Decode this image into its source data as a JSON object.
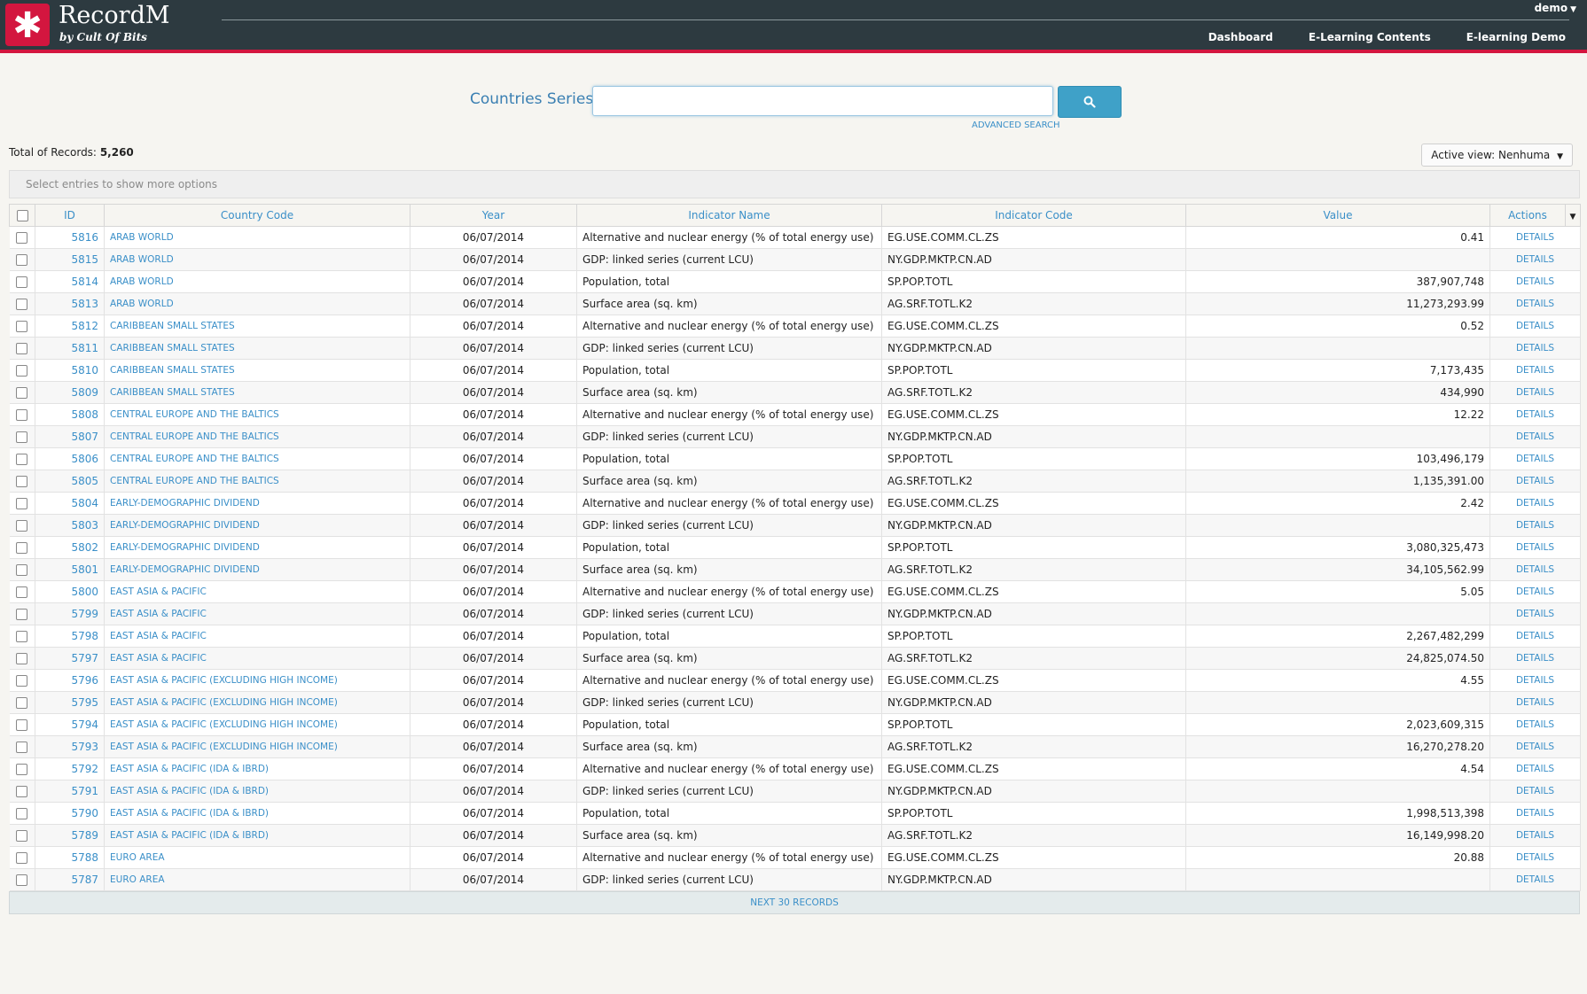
{
  "header": {
    "logo_glyph": "✱",
    "brand": "RecordM",
    "tagline": "by Cult Of Bits",
    "user": "demo",
    "nav": [
      "Dashboard",
      "E-Learning Contents",
      "E-learning Demo"
    ]
  },
  "search": {
    "label": "Countries Series",
    "value": "",
    "advanced_label": "ADVANCED SEARCH"
  },
  "records": {
    "total_label": "Total of Records:",
    "total_value": "5,260",
    "active_view_label": "Active view:",
    "active_view_value": "Nenhuma",
    "options_hint": "Select entries to show more options"
  },
  "table": {
    "columns": [
      "ID",
      "Country Code",
      "Year",
      "Indicator Name",
      "Indicator Code",
      "Value",
      "Actions"
    ],
    "action_label": "DETAILS",
    "rows": [
      {
        "id": "5816",
        "country": "ARAB WORLD",
        "year": "06/07/2014",
        "indicator_name": "Alternative and nuclear energy (% of total energy use)",
        "indicator_code": "EG.USE.COMM.CL.ZS",
        "value": "0.41"
      },
      {
        "id": "5815",
        "country": "ARAB WORLD",
        "year": "06/07/2014",
        "indicator_name": "GDP: linked series (current LCU)",
        "indicator_code": "NY.GDP.MKTP.CN.AD",
        "value": ""
      },
      {
        "id": "5814",
        "country": "ARAB WORLD",
        "year": "06/07/2014",
        "indicator_name": "Population, total",
        "indicator_code": "SP.POP.TOTL",
        "value": "387,907,748"
      },
      {
        "id": "5813",
        "country": "ARAB WORLD",
        "year": "06/07/2014",
        "indicator_name": "Surface area (sq. km)",
        "indicator_code": "AG.SRF.TOTL.K2",
        "value": "11,273,293.99"
      },
      {
        "id": "5812",
        "country": "CARIBBEAN SMALL STATES",
        "year": "06/07/2014",
        "indicator_name": "Alternative and nuclear energy (% of total energy use)",
        "indicator_code": "EG.USE.COMM.CL.ZS",
        "value": "0.52"
      },
      {
        "id": "5811",
        "country": "CARIBBEAN SMALL STATES",
        "year": "06/07/2014",
        "indicator_name": "GDP: linked series (current LCU)",
        "indicator_code": "NY.GDP.MKTP.CN.AD",
        "value": ""
      },
      {
        "id": "5810",
        "country": "CARIBBEAN SMALL STATES",
        "year": "06/07/2014",
        "indicator_name": "Population, total",
        "indicator_code": "SP.POP.TOTL",
        "value": "7,173,435"
      },
      {
        "id": "5809",
        "country": "CARIBBEAN SMALL STATES",
        "year": "06/07/2014",
        "indicator_name": "Surface area (sq. km)",
        "indicator_code": "AG.SRF.TOTL.K2",
        "value": "434,990"
      },
      {
        "id": "5808",
        "country": "CENTRAL EUROPE AND THE BALTICS",
        "year": "06/07/2014",
        "indicator_name": "Alternative and nuclear energy (% of total energy use)",
        "indicator_code": "EG.USE.COMM.CL.ZS",
        "value": "12.22"
      },
      {
        "id": "5807",
        "country": "CENTRAL EUROPE AND THE BALTICS",
        "year": "06/07/2014",
        "indicator_name": "GDP: linked series (current LCU)",
        "indicator_code": "NY.GDP.MKTP.CN.AD",
        "value": ""
      },
      {
        "id": "5806",
        "country": "CENTRAL EUROPE AND THE BALTICS",
        "year": "06/07/2014",
        "indicator_name": "Population, total",
        "indicator_code": "SP.POP.TOTL",
        "value": "103,496,179"
      },
      {
        "id": "5805",
        "country": "CENTRAL EUROPE AND THE BALTICS",
        "year": "06/07/2014",
        "indicator_name": "Surface area (sq. km)",
        "indicator_code": "AG.SRF.TOTL.K2",
        "value": "1,135,391.00"
      },
      {
        "id": "5804",
        "country": "EARLY-DEMOGRAPHIC DIVIDEND",
        "year": "06/07/2014",
        "indicator_name": "Alternative and nuclear energy (% of total energy use)",
        "indicator_code": "EG.USE.COMM.CL.ZS",
        "value": "2.42"
      },
      {
        "id": "5803",
        "country": "EARLY-DEMOGRAPHIC DIVIDEND",
        "year": "06/07/2014",
        "indicator_name": "GDP: linked series (current LCU)",
        "indicator_code": "NY.GDP.MKTP.CN.AD",
        "value": ""
      },
      {
        "id": "5802",
        "country": "EARLY-DEMOGRAPHIC DIVIDEND",
        "year": "06/07/2014",
        "indicator_name": "Population, total",
        "indicator_code": "SP.POP.TOTL",
        "value": "3,080,325,473"
      },
      {
        "id": "5801",
        "country": "EARLY-DEMOGRAPHIC DIVIDEND",
        "year": "06/07/2014",
        "indicator_name": "Surface area (sq. km)",
        "indicator_code": "AG.SRF.TOTL.K2",
        "value": "34,105,562.99"
      },
      {
        "id": "5800",
        "country": "EAST ASIA & PACIFIC",
        "year": "06/07/2014",
        "indicator_name": "Alternative and nuclear energy (% of total energy use)",
        "indicator_code": "EG.USE.COMM.CL.ZS",
        "value": "5.05"
      },
      {
        "id": "5799",
        "country": "EAST ASIA & PACIFIC",
        "year": "06/07/2014",
        "indicator_name": "GDP: linked series (current LCU)",
        "indicator_code": "NY.GDP.MKTP.CN.AD",
        "value": ""
      },
      {
        "id": "5798",
        "country": "EAST ASIA & PACIFIC",
        "year": "06/07/2014",
        "indicator_name": "Population, total",
        "indicator_code": "SP.POP.TOTL",
        "value": "2,267,482,299"
      },
      {
        "id": "5797",
        "country": "EAST ASIA & PACIFIC",
        "year": "06/07/2014",
        "indicator_name": "Surface area (sq. km)",
        "indicator_code": "AG.SRF.TOTL.K2",
        "value": "24,825,074.50"
      },
      {
        "id": "5796",
        "country": "EAST ASIA & PACIFIC (EXCLUDING HIGH INCOME)",
        "year": "06/07/2014",
        "indicator_name": "Alternative and nuclear energy (% of total energy use)",
        "indicator_code": "EG.USE.COMM.CL.ZS",
        "value": "4.55"
      },
      {
        "id": "5795",
        "country": "EAST ASIA & PACIFIC (EXCLUDING HIGH INCOME)",
        "year": "06/07/2014",
        "indicator_name": "GDP: linked series (current LCU)",
        "indicator_code": "NY.GDP.MKTP.CN.AD",
        "value": ""
      },
      {
        "id": "5794",
        "country": "EAST ASIA & PACIFIC (EXCLUDING HIGH INCOME)",
        "year": "06/07/2014",
        "indicator_name": "Population, total",
        "indicator_code": "SP.POP.TOTL",
        "value": "2,023,609,315"
      },
      {
        "id": "5793",
        "country": "EAST ASIA & PACIFIC (EXCLUDING HIGH INCOME)",
        "year": "06/07/2014",
        "indicator_name": "Surface area (sq. km)",
        "indicator_code": "AG.SRF.TOTL.K2",
        "value": "16,270,278.20"
      },
      {
        "id": "5792",
        "country": "EAST ASIA & PACIFIC (IDA & IBRD)",
        "year": "06/07/2014",
        "indicator_name": "Alternative and nuclear energy (% of total energy use)",
        "indicator_code": "EG.USE.COMM.CL.ZS",
        "value": "4.54"
      },
      {
        "id": "5791",
        "country": "EAST ASIA & PACIFIC (IDA & IBRD)",
        "year": "06/07/2014",
        "indicator_name": "GDP: linked series (current LCU)",
        "indicator_code": "NY.GDP.MKTP.CN.AD",
        "value": ""
      },
      {
        "id": "5790",
        "country": "EAST ASIA & PACIFIC (IDA & IBRD)",
        "year": "06/07/2014",
        "indicator_name": "Population, total",
        "indicator_code": "SP.POP.TOTL",
        "value": "1,998,513,398"
      },
      {
        "id": "5789",
        "country": "EAST ASIA & PACIFIC (IDA & IBRD)",
        "year": "06/07/2014",
        "indicator_name": "Surface area (sq. km)",
        "indicator_code": "AG.SRF.TOTL.K2",
        "value": "16,149,998.20"
      },
      {
        "id": "5788",
        "country": "EURO AREA",
        "year": "06/07/2014",
        "indicator_name": "Alternative and nuclear energy (% of total energy use)",
        "indicator_code": "EG.USE.COMM.CL.ZS",
        "value": "20.88"
      },
      {
        "id": "5787",
        "country": "EURO AREA",
        "year": "06/07/2014",
        "indicator_name": "GDP: linked series (current LCU)",
        "indicator_code": "NY.GDP.MKTP.CN.AD",
        "value": ""
      }
    ],
    "next_label": "NEXT 30 RECORDS"
  },
  "colors": {
    "header_bg": "#2d3a40",
    "brand_red": "#d3163f",
    "link_blue": "#3a8fc8",
    "search_button": "#3fa1c8"
  }
}
